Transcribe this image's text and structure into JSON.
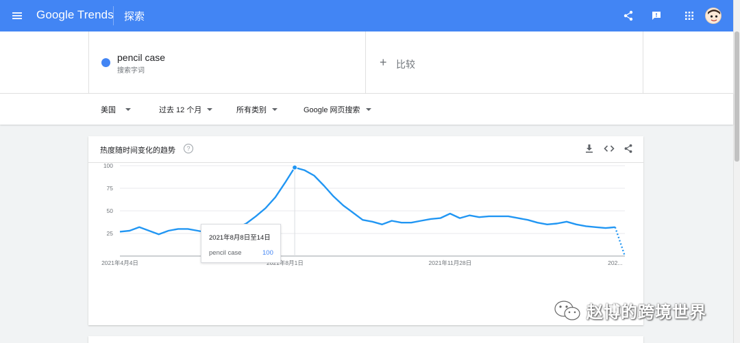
{
  "header": {
    "logo": "Google Trends",
    "page": "探索"
  },
  "search": {
    "term": "pencil case",
    "term_type": "搜索字词",
    "compare_label": "比较"
  },
  "filters": {
    "region": "美国",
    "period": "过去 12 个月",
    "category": "所有类别",
    "search_type": "Google 网页搜索"
  },
  "card": {
    "title": "热度随时间变化的趋势"
  },
  "tooltip": {
    "date": "2021年8月8日至14日",
    "term": "pencil case",
    "value": "100"
  },
  "watermark": {
    "text": "赵博的跨境世界"
  },
  "colors": {
    "brand": "#4285f4",
    "series": "#2196f3"
  },
  "chart_data": {
    "type": "line",
    "ylim": [
      0,
      100
    ],
    "yticks": [
      "100",
      "75",
      "50",
      "25"
    ],
    "xticks": [
      "2021年4月4日",
      "2021年8月1日",
      "2021年11月28日",
      "202..."
    ],
    "x_tick_index": [
      0,
      17,
      34,
      51
    ],
    "series": [
      {
        "name": "pencil case",
        "values": [
          27,
          28,
          32,
          28,
          24,
          28,
          30,
          30,
          28,
          26,
          24,
          27,
          31,
          36,
          44,
          53,
          65,
          81,
          98,
          95,
          89,
          78,
          66,
          56,
          48,
          40,
          38,
          35,
          39,
          37,
          37,
          39,
          41,
          42,
          47,
          42,
          45,
          43,
          44,
          44,
          44,
          42,
          40,
          37,
          35,
          36,
          38,
          35,
          33,
          32,
          31,
          32,
          0
        ],
        "partial_from_index": 51
      }
    ],
    "highlight_index": 18
  }
}
